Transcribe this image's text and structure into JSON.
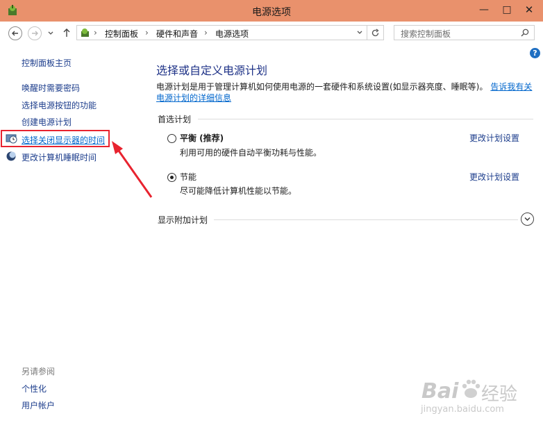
{
  "window": {
    "title": "电源选项"
  },
  "address": {
    "breadcrumbs": [
      "控制面板",
      "硬件和声音",
      "电源选项"
    ],
    "search_placeholder": "搜索控制面板"
  },
  "sidebar": {
    "home": "控制面板主页",
    "tasks": [
      "唤醒时需要密码",
      "选择电源按钮的功能",
      "创建电源计划",
      "选择关闭显示器的时间",
      "更改计算机睡眠时间"
    ],
    "see_also_title": "另请参阅",
    "see_also": [
      "个性化",
      "用户帐户"
    ]
  },
  "main": {
    "heading": "选择或自定义电源计划",
    "intro_line1": "电源计划是用于管理计算机如何使用电源的一套硬件和系统设置(如显示器亮度、睡眠等)。",
    "intro_link1": "告诉我有关",
    "intro_link2": "电源计划的详细信息",
    "preferred_title": "首选计划",
    "plans": [
      {
        "name": "平衡 (推荐)",
        "desc": "利用可用的硬件自动平衡功耗与性能。",
        "change": "更改计划设置",
        "selected": false
      },
      {
        "name": "节能",
        "desc": "尽可能降低计算机性能以节能。",
        "change": "更改计划设置",
        "selected": true
      }
    ],
    "more_plans": "显示附加计划"
  },
  "watermark": {
    "brand": "Bai",
    "brand2": "经验",
    "url": "jingyan.baidu.com"
  },
  "colors": {
    "titlebar": "#e9916c",
    "heading": "#1e3287",
    "highlight": "#e8232f",
    "link": "#0066cc"
  }
}
